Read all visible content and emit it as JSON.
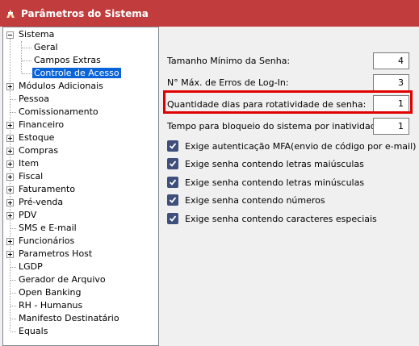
{
  "window": {
    "title": "Parâmetros do Sistema",
    "icon": "app-logo-icon"
  },
  "tree": {
    "root": {
      "label": "Sistema",
      "expanded": true
    },
    "children": [
      {
        "label": "Geral",
        "selected": false
      },
      {
        "label": "Campos Extras",
        "selected": false
      },
      {
        "label": "Controle de Acesso",
        "selected": true
      }
    ],
    "items": [
      {
        "label": "Módulos Adicionais",
        "expandable": true
      },
      {
        "label": "Pessoa",
        "expandable": false
      },
      {
        "label": "Comissionamento",
        "expandable": false
      },
      {
        "label": "Financeiro",
        "expandable": true
      },
      {
        "label": "Estoque",
        "expandable": true
      },
      {
        "label": "Compras",
        "expandable": true
      },
      {
        "label": "Item",
        "expandable": true
      },
      {
        "label": "Fiscal",
        "expandable": true
      },
      {
        "label": "Faturamento",
        "expandable": true
      },
      {
        "label": "Pré-venda",
        "expandable": true
      },
      {
        "label": "PDV",
        "expandable": true
      },
      {
        "label": "SMS e E-mail",
        "expandable": false
      },
      {
        "label": "Funcionários",
        "expandable": true
      },
      {
        "label": "Parametros Host",
        "expandable": true
      },
      {
        "label": "LGDP",
        "expandable": false
      },
      {
        "label": "Gerador de Arquivo",
        "expandable": false
      },
      {
        "label": "Open Banking",
        "expandable": false
      },
      {
        "label": "RH - Humanus",
        "expandable": false
      },
      {
        "label": "Manifesto Destinatário",
        "expandable": false
      },
      {
        "label": "Equals",
        "expandable": false
      }
    ]
  },
  "settings": {
    "min_password_size": {
      "label": "Tamanho Mínimo da Senha:",
      "value": "4"
    },
    "max_login_errors": {
      "label": "N° Máx. de Erros de Log-In:",
      "value": "3"
    },
    "password_rotation_days": {
      "label": "Quantidade dias para rotatividade de senha:",
      "value": "1"
    },
    "inactivity_lock_time": {
      "label": "Tempo para bloqueio do sistema por inatividade(min):",
      "value": "1"
    }
  },
  "checkboxes": [
    {
      "label": "Exige autenticação MFA(envio de código por e-mail)",
      "checked": true
    },
    {
      "label": "Exige senha contendo letras maiúsculas",
      "checked": true
    },
    {
      "label": "Exige senha contendo letras minúsculas",
      "checked": true
    },
    {
      "label": "Exige senha contendo números",
      "checked": true
    },
    {
      "label": "Exige senha contendo caracteres especiais",
      "checked": true
    }
  ],
  "colors": {
    "titlebar": "#c13d3d",
    "selection": "#0a64d8",
    "highlight_border": "#e00000",
    "checkbox": "#3d4f7a"
  }
}
